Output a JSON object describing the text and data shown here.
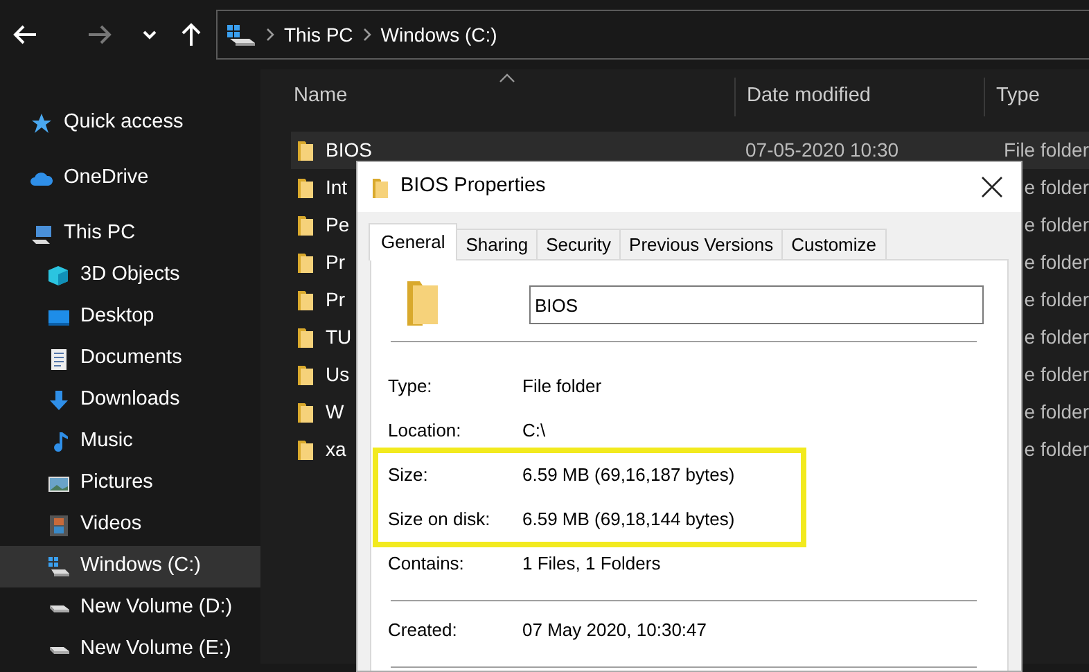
{
  "nav_buttons": [
    {
      "kind": "back",
      "disabled": false
    },
    {
      "kind": "forward",
      "disabled": true
    },
    {
      "kind": "recent",
      "disabled": false
    },
    {
      "kind": "up",
      "disabled": false
    }
  ],
  "address_bar": {
    "segments": [
      "This PC",
      "Windows (C:)"
    ]
  },
  "sidebar": {
    "items": [
      {
        "label": "Quick access",
        "kind": "star",
        "selected": false
      },
      {
        "label": "OneDrive",
        "kind": "cloud",
        "selected": false
      },
      {
        "label": "This PC",
        "kind": "pc",
        "selected": false,
        "children": [
          {
            "label": "3D Objects",
            "kind": "cube",
            "selected": false
          },
          {
            "label": "Desktop",
            "kind": "desktop",
            "selected": false
          },
          {
            "label": "Documents",
            "kind": "document",
            "selected": false
          },
          {
            "label": "Downloads",
            "kind": "download",
            "selected": false
          },
          {
            "label": "Music",
            "kind": "music",
            "selected": false
          },
          {
            "label": "Pictures",
            "kind": "picture",
            "selected": false
          },
          {
            "label": "Videos",
            "kind": "video",
            "selected": false
          },
          {
            "label": "Windows (C:)",
            "kind": "system-drive",
            "selected": true
          },
          {
            "label": "New Volume (D:)",
            "kind": "drive",
            "selected": false
          },
          {
            "label": "New Volume (E:)",
            "kind": "drive",
            "selected": false
          }
        ]
      }
    ]
  },
  "file_list": {
    "columns": [
      "Name",
      "Date modified",
      "Type"
    ],
    "rows": [
      {
        "name": "BIOS",
        "date_modified": "07-05-2020 10:30",
        "type": "File folder",
        "selected": true
      },
      {
        "name": "Int",
        "type": "e folder",
        "selected": false
      },
      {
        "name": "Pe",
        "type": "e folder",
        "selected": false
      },
      {
        "name": "Pr",
        "type": "e folder",
        "selected": false
      },
      {
        "name": "Pr",
        "type": "e folder",
        "selected": false
      },
      {
        "name": "TU",
        "type": "e folder",
        "selected": false
      },
      {
        "name": "Us",
        "type": "e folder",
        "selected": false
      },
      {
        "name": "W",
        "type": "e folder",
        "selected": false
      },
      {
        "name": "xa",
        "type": "e folder",
        "selected": false
      }
    ]
  },
  "dialog": {
    "title": "BIOS Properties",
    "tabs": [
      {
        "label": "General",
        "selected": true
      },
      {
        "label": "Sharing",
        "selected": false
      },
      {
        "label": "Security",
        "selected": false
      },
      {
        "label": "Previous Versions",
        "selected": false
      },
      {
        "label": "Customize",
        "selected": false
      }
    ],
    "name_value": "BIOS",
    "sections": [
      {
        "groups": [
          {
            "highlighted": false,
            "rows": [
              {
                "label": "Type:",
                "value": "File folder"
              },
              {
                "label": "Location:",
                "value": "C:\\"
              }
            ]
          },
          {
            "highlighted": true,
            "rows": [
              {
                "label": "Size:",
                "value": "6.59 MB (69,16,187 bytes)"
              },
              {
                "label": "Size on disk:",
                "value": "6.59 MB (69,18,144 bytes)"
              }
            ]
          },
          {
            "highlighted": false,
            "rows": [
              {
                "label": "Contains:",
                "value": "1 Files, 1 Folders"
              }
            ]
          }
        ]
      },
      {
        "groups": [
          {
            "highlighted": false,
            "rows": [
              {
                "label": "Created:",
                "value": "07 May 2020, 10:30:47"
              }
            ]
          }
        ]
      }
    ]
  }
}
